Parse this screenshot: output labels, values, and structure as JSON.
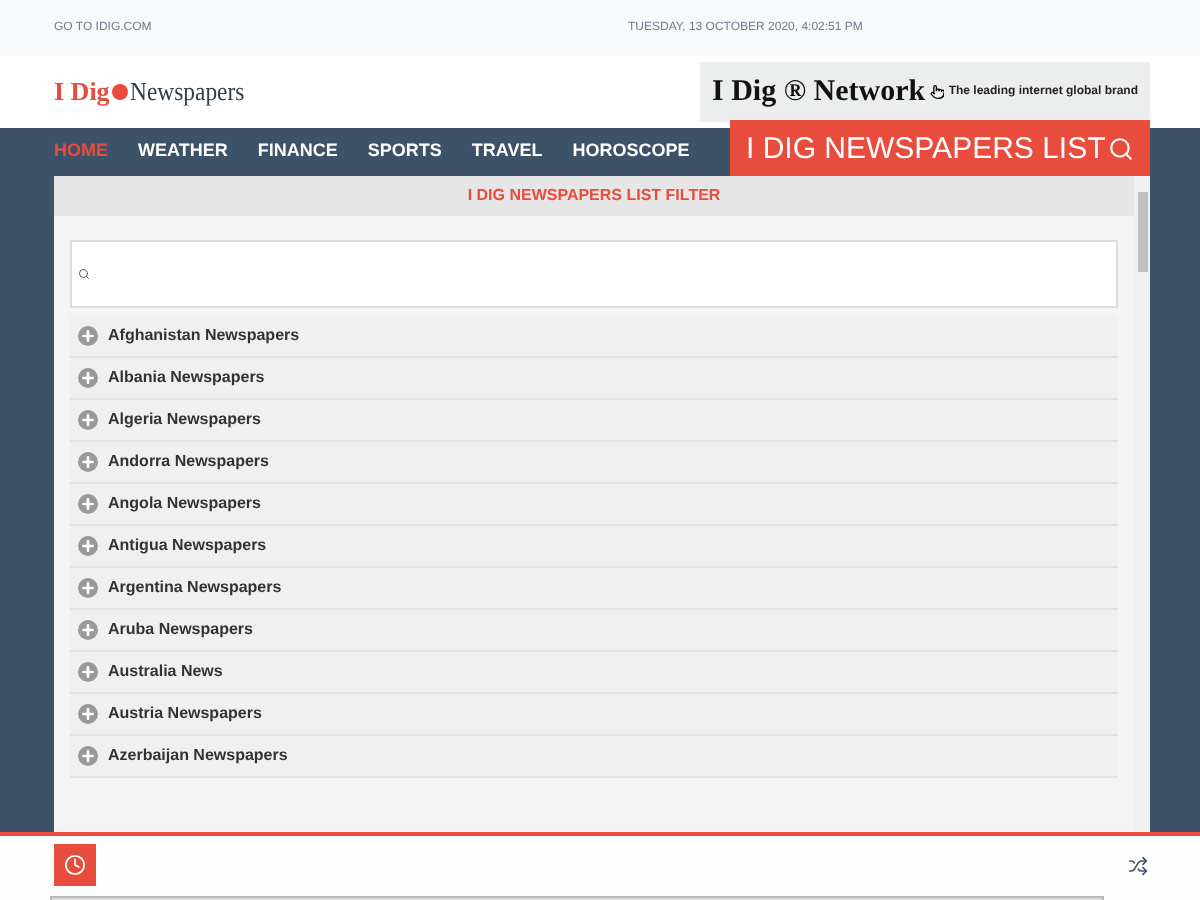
{
  "top_bar": {
    "link": "GO TO IDIG.COM",
    "date": "TUESDAY, 13 OCTOBER 2020, 4:02:51 PM"
  },
  "logo": {
    "part_1": "I Dig",
    "part_2": "Newspapers"
  },
  "banner": {
    "title": "I Dig ® Network",
    "tagline": "The leading internet global brand"
  },
  "nav": [
    {
      "label": "HOME",
      "selected": true
    },
    {
      "label": "WEATHER",
      "selected": false
    },
    {
      "label": "FINANCE",
      "selected": false
    },
    {
      "label": "SPORTS",
      "selected": false
    },
    {
      "label": "TRAVEL",
      "selected": false
    },
    {
      "label": "HOROSCOPE",
      "selected": false
    }
  ],
  "list_button": "I DIG NEWSPAPERS LIST",
  "panel": {
    "title": "I DIG NEWSPAPERS LIST FILTER",
    "items": [
      "Afghanistan Newspapers",
      "Albania Newspapers",
      "Algeria Newspapers",
      "Andorra Newspapers",
      "Angola Newspapers",
      "Antigua Newspapers",
      "Argentina Newspapers",
      "Aruba Newspapers",
      "Australia News",
      "Austria Newspapers",
      "Azerbaijan Newspapers"
    ]
  }
}
